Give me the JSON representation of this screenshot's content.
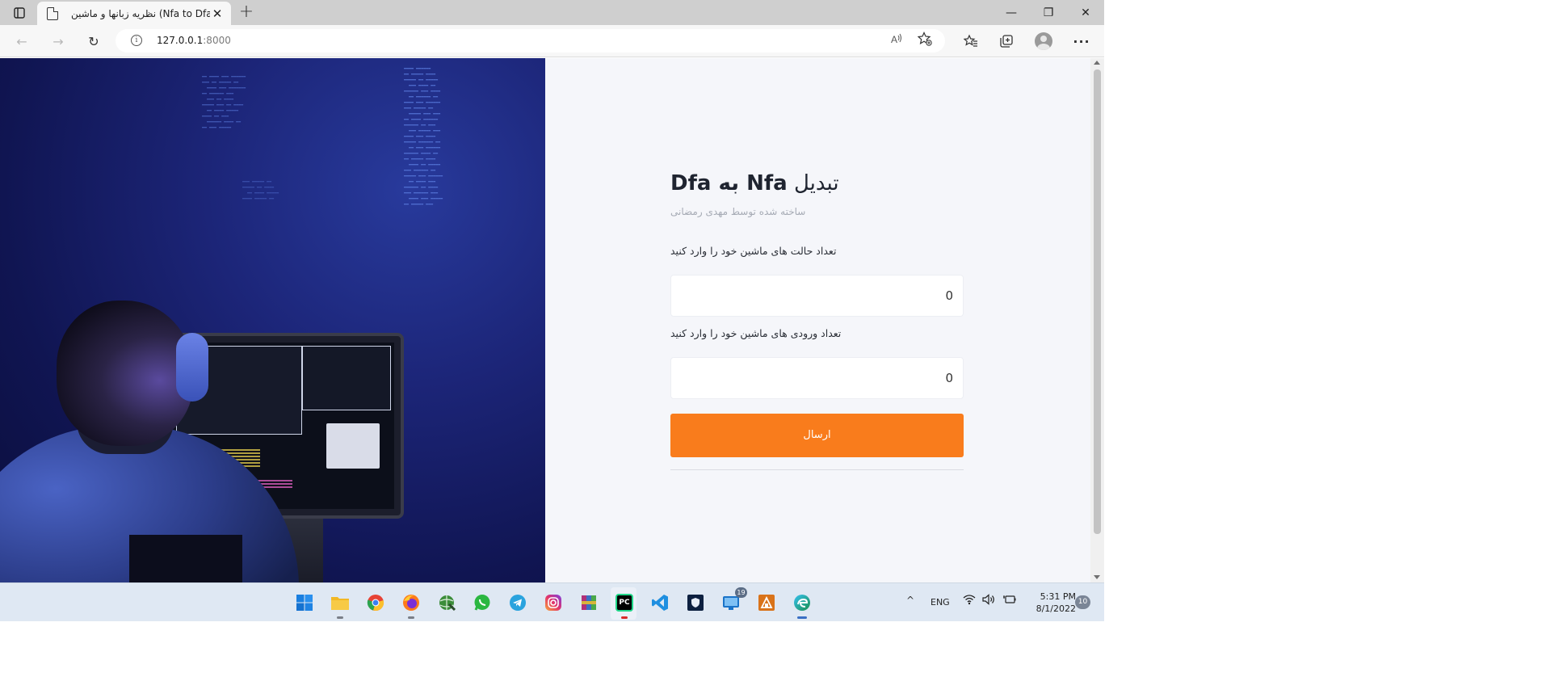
{
  "browser": {
    "tab_title": "نظریه زبانها و ماشین (Nfa to Dfa)",
    "new_tab_symbol": "+",
    "tab_close_symbol": "✕",
    "url_host": "127.0.0.1",
    "url_port": ":8000",
    "info_symbol": "i",
    "read_aloud_symbol": "A​",
    "window_controls": {
      "minimize": "—",
      "maximize": "❐",
      "close": "✕"
    },
    "nav": {
      "back": "←",
      "forward": "→",
      "refresh": "↻"
    },
    "toolbar_icons": [
      "favorites-icon",
      "collections-icon",
      "profile-icon",
      "menu-icon"
    ]
  },
  "page": {
    "title_ar": "تبدیل",
    "title_en": "Nfa به Dfa",
    "subtitle": "ساخته شده توسط مهدی رمضانی",
    "states_label": "تعداد حالت های ماشین خود را وارد کنید",
    "states_value": "0",
    "inputs_label": "تعداد ورودی های ماشین خود را وارد کنید",
    "inputs_value": "0",
    "submit_label": "ارسال",
    "accent_color": "#f97c1c"
  },
  "taskbar": {
    "apps": [
      {
        "name": "start-icon"
      },
      {
        "name": "file-explorer-icon"
      },
      {
        "name": "chrome-icon"
      },
      {
        "name": "firefox-icon"
      },
      {
        "name": "network-globe-icon"
      },
      {
        "name": "whatsapp-icon"
      },
      {
        "name": "telegram-icon"
      },
      {
        "name": "instagram-icon"
      },
      {
        "name": "winrar-icon"
      },
      {
        "name": "pycharm-icon"
      },
      {
        "name": "vscode-icon"
      },
      {
        "name": "shield-app-icon"
      },
      {
        "name": "remote-desktop-icon",
        "badge": "19"
      },
      {
        "name": "sublime-app-icon"
      },
      {
        "name": "edge-icon"
      }
    ],
    "pycharm_label": "PC",
    "chevron": "^",
    "language": "ENG",
    "time": "5:31 PM",
    "date": "8/1/2022",
    "notifications": "10"
  }
}
